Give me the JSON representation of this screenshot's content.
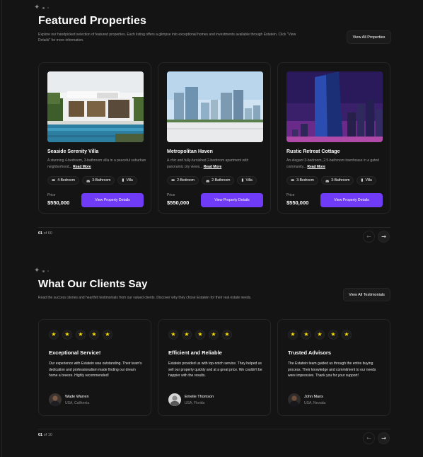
{
  "featured": {
    "title": "Featured Properties",
    "description": "Explore our handpicked selection of featured properties. Each listing offers a glimpse into exceptional homes and investments available through Estatein. Click \"View Details\" for more information.",
    "view_all_label": "View All Properties",
    "price_label": "Price",
    "details_label": "View Property Details",
    "read_more": "Read More",
    "properties": [
      {
        "title": "Seaside Serenity Villa",
        "description": "A stunning 4-bedroom, 3-bathroom villa in a peaceful suburban neighborhood...",
        "bedrooms": "4-Bedroom",
        "bathrooms": "3-Bathroom",
        "type": "Villa",
        "price": "$550,000"
      },
      {
        "title": "Metropolitan Haven",
        "description": "A chic and fully-furnished 2-bedroom apartment with panoramic city views...",
        "bedrooms": "2-Bedroom",
        "bathrooms": "2-Bathroom",
        "type": "Villa",
        "price": "$550,000"
      },
      {
        "title": "Rustic Retreat Cottage",
        "description": "An elegant 3-bedroom, 2.5-bathroom townhouse in a gated community...",
        "bedrooms": "3-Bedroom",
        "bathrooms": "3-Bathroom",
        "type": "Villa",
        "price": "$550,000"
      }
    ],
    "pager": {
      "current": "01",
      "separator": " of ",
      "total": "60"
    }
  },
  "testimonials": {
    "title": "What Our Clients Say",
    "description": "Read the success stories and heartfelt testimonials from our valued clients. Discover why they chose Estatein for their real estate needs.",
    "view_all_label": "View All Testimonials",
    "items": [
      {
        "rating": 5,
        "title": "Exceptional Service!",
        "body": "Our experience with Estatein was outstanding. Their team's dedication and professionalism made finding our dream home a breeze. Highly recommended!",
        "name": "Wade Warren",
        "location": "USA, California"
      },
      {
        "rating": 5,
        "title": "Efficient and Reliable",
        "body": "Estatein provided us with top-notch service. They helped us sell our property quickly and at a great price. We couldn't be happier with the results.",
        "name": "Emelie Thomson",
        "location": "USA, Florida"
      },
      {
        "rating": 5,
        "title": "Trusted Advisors",
        "body": "The Estatein team guided us through the entire buying process. Their knowledge and commitment to our needs were impressive. Thank you for your support!",
        "name": "John Mans",
        "location": "USA, Nevada"
      }
    ],
    "pager": {
      "current": "01",
      "separator": " of ",
      "total": "10"
    }
  },
  "icons": {
    "sparkle": "sparkle-icon",
    "bed": "bed-icon",
    "bath": "bath-icon",
    "building": "building-icon",
    "star": "star-icon",
    "arrow_left": "arrow-left-icon",
    "arrow_right": "arrow-right-icon"
  },
  "colors": {
    "background": "#141414",
    "accent": "#703bf7",
    "border": "#262626",
    "star": "#ffe100",
    "muted_text": "#9a9a9a"
  }
}
